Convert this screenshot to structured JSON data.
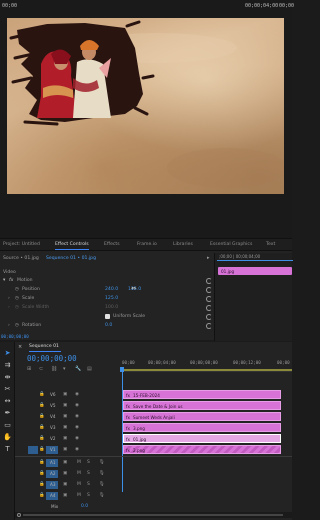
{
  "monitor": {
    "timecodes": [
      "00;00",
      "00;00;04;00",
      "00;00"
    ]
  },
  "panel_tabs": {
    "tabs": [
      "Project: Untitled",
      "Effect Controls",
      "Effects",
      "Frame.io",
      "Libraries",
      "Essential Graphics",
      "Text"
    ]
  },
  "effect_controls": {
    "source_label": "Source • 01.jpg",
    "sequence_label": "Sequence 01 • 01.jpg",
    "section": "Video",
    "fx_label": "fx",
    "motion": "Motion",
    "position_label": "Position",
    "position_x": "240.0",
    "position_y": "135.0",
    "scale_label": "Scale",
    "scale_value": "125.0",
    "scale_width_label": "Scale Width",
    "scale_width_value": "100.0",
    "uniform_scale": "Uniform Scale",
    "rotation_label": "Rotation",
    "rotation_value": "0.0",
    "clip_label": "01.jpg",
    "bottom_timecode": "00;00;00;00"
  },
  "timeline": {
    "sequence_tab": "Sequence 01",
    "timecode": "00;00;00;00",
    "ruler_ticks": [
      "00;00",
      "00;00;04;00",
      "00;00;08;00",
      "00;00;12;00",
      "00;00"
    ],
    "tracks": [
      "V6",
      "V5",
      "V4",
      "V3",
      "V2",
      "V1",
      "A1",
      "A2",
      "A3",
      "A4"
    ],
    "track_flags": [
      "M",
      "S"
    ],
    "mix_label": "Mix",
    "mix_value": "0.0",
    "clips": [
      {
        "label": "15-FEB-2024",
        "fx": "fx"
      },
      {
        "label": "Save the Date & Join us",
        "fx": "fx"
      },
      {
        "label": "Sumeet Weds Anjali",
        "fx": "fx"
      },
      {
        "label": "3.png",
        "fx": "fx"
      },
      {
        "label": "01.jpg",
        "fx": "fx"
      },
      {
        "label": "2.png",
        "fx": "fx"
      }
    ]
  },
  "colors": {
    "accent": "#3d8fe8",
    "clip": "#d773d6",
    "panel_bg": "#232323"
  }
}
